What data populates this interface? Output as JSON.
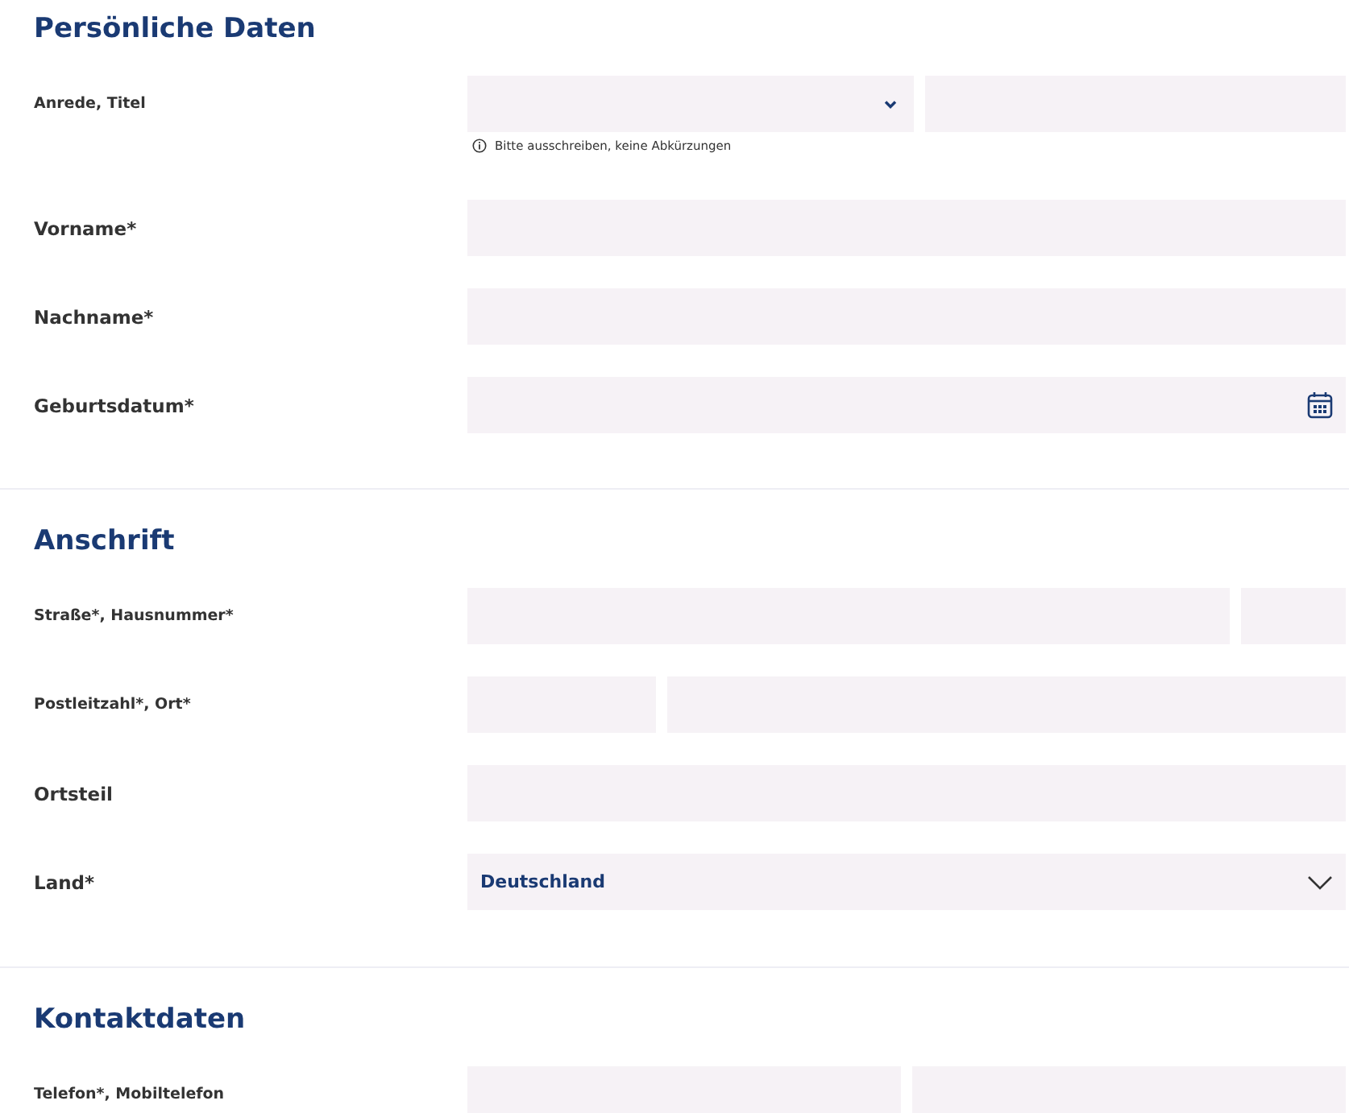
{
  "sections": [
    {
      "title": "Persönliche Daten",
      "rows": [
        {
          "label": "Anrede, Titel",
          "fields": [
            {
              "kind": "select"
            },
            {
              "kind": "text"
            }
          ],
          "hint": "Bitte ausschreiben, keine Abkürzungen"
        },
        {
          "label": "Vorname*",
          "fields": [
            {
              "kind": "text"
            }
          ]
        },
        {
          "label": "Nachname*",
          "fields": [
            {
              "kind": "text"
            }
          ]
        },
        {
          "label": "Geburtsdatum*",
          "fields": [
            {
              "kind": "date"
            }
          ]
        }
      ]
    },
    {
      "title": "Anschrift",
      "rows": [
        {
          "label": "Straße*, Hausnummer*",
          "fields": [
            {
              "kind": "text"
            },
            {
              "kind": "text"
            }
          ]
        },
        {
          "label": "Postleitzahl*, Ort*",
          "fields": [
            {
              "kind": "text"
            },
            {
              "kind": "text"
            }
          ]
        },
        {
          "label": "Ortsteil",
          "fields": [
            {
              "kind": "text"
            }
          ]
        },
        {
          "label": "Land*",
          "fields": [
            {
              "kind": "dropdown",
              "value": "Deutschland"
            }
          ]
        }
      ]
    },
    {
      "title": "Kontaktdaten",
      "rows": [
        {
          "label": "Telefon*, Mobiltelefon",
          "fields": [
            {
              "kind": "text"
            },
            {
              "kind": "text"
            }
          ]
        }
      ]
    }
  ]
}
